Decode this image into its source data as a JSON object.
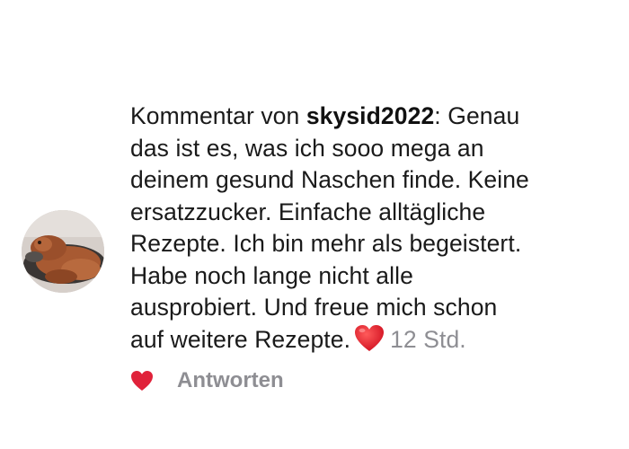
{
  "comment": {
    "prefix": "Kommentar von",
    "username": "skysid2022",
    "separator": ":",
    "text_line_1": "Genau",
    "text_line_2": "das ist es, was ich sooo mega an",
    "text_line_3": "deinem gesund Naschen finde. Keine",
    "text_line_4": "ersatzzucker. Einfache alltägliche",
    "text_line_5": "Rezepte. Ich bin mehr als begeistert.",
    "text_line_6": "Habe noch lange nicht alle",
    "text_line_7": "ausprobiert.  Und freue mich schon",
    "text_line_8": "auf weitere Rezepte.",
    "emoji": "red-heart-emoji",
    "timestamp": "12 Std."
  },
  "avatar": {
    "icon": "user-avatar-photo"
  },
  "actions": {
    "like_icon": "heart-icon",
    "like_color": "#e0223a",
    "reply_label": "Antworten"
  },
  "colors": {
    "text": "#1a1a1a",
    "muted": "#8e8e93",
    "heart": "#e0223a"
  }
}
